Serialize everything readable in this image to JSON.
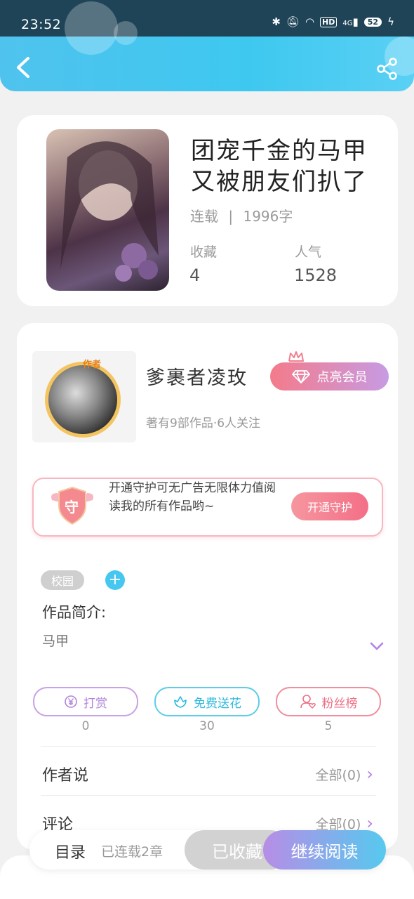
{
  "status_bar": {
    "time": "23:52",
    "icons": [
      "bluetooth-icon",
      "mute-icon",
      "wifi-icon",
      "hd-icon",
      "4g-signal-icon",
      "battery-icon",
      "charging-icon"
    ],
    "hd": "HD",
    "network": "4G",
    "battery": "52"
  },
  "header": {
    "back_icon": "chevron-left-icon",
    "share_icon": "share-icon",
    "accent": "#45c5ef"
  },
  "book": {
    "title": "团宠千金的马甲又被朋友们扒了",
    "status": "连载",
    "separator": "|",
    "word_count": "1996字",
    "favorites_label": "收藏",
    "favorites_value": "4",
    "popularity_label": "人气",
    "popularity_value": "1528"
  },
  "author": {
    "tag": "作者",
    "name": "爹裹者凌玫",
    "vip_button": "点亮会员",
    "meta": "著有9部作品·6人关注"
  },
  "guard": {
    "badge": "守",
    "text": "开通守护可无广告无限体力值阅读我的所有作品哟~",
    "button": "开通守护"
  },
  "tags": {
    "items": [
      "校园"
    ],
    "add": "+"
  },
  "intro": {
    "label": "作品简介:",
    "text": "马甲"
  },
  "actions": [
    {
      "label": "打赏",
      "icon": "yen-icon",
      "count": "0"
    },
    {
      "label": "免费送花",
      "icon": "flower-icon",
      "count": "30"
    },
    {
      "label": "粉丝榜",
      "icon": "fan-icon",
      "count": "5"
    }
  ],
  "rows": [
    {
      "label": "作者说",
      "value": "全部(0)"
    },
    {
      "label": "评论",
      "value": "全部(0)"
    }
  ],
  "bottom": {
    "toc": "目录",
    "chapters": "已连载2章",
    "saved": "已收藏",
    "read": "继续阅读"
  }
}
